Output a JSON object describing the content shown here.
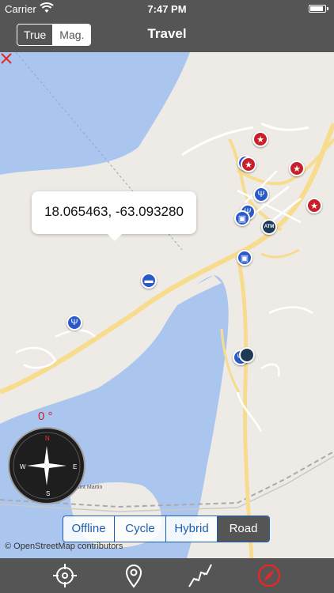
{
  "status_bar": {
    "carrier": "Carrier",
    "time": "7:47 PM",
    "battery_level": 0.9
  },
  "nav_bar": {
    "north_toggle": [
      {
        "label": "True",
        "selected": true
      },
      {
        "label": "Mag.",
        "selected": false
      }
    ],
    "title": "Travel"
  },
  "map": {
    "coordinate_callout": "18.065463, -63.093280",
    "heading_readout": "0 °",
    "compass": {
      "north": "N",
      "south": "S",
      "east": "E",
      "west": "W"
    },
    "map_labels": [
      "Saint Martin"
    ],
    "attribution": "© OpenStreetMap contributors",
    "colors": {
      "water": "#aac6ee",
      "land": "#eeebe6",
      "road": "#f7dc8e",
      "blue_poi": "#2a59c9",
      "red_poi": "#c8202a"
    }
  },
  "map_type": {
    "options": [
      "Offline",
      "Cycle",
      "Hybrid",
      "Road"
    ],
    "selected": "Road"
  },
  "toolbar": {
    "items": [
      {
        "icon": "crosshair-icon"
      },
      {
        "icon": "location-pin-icon"
      },
      {
        "icon": "route-icon"
      },
      {
        "icon": "compass-icon"
      }
    ]
  }
}
